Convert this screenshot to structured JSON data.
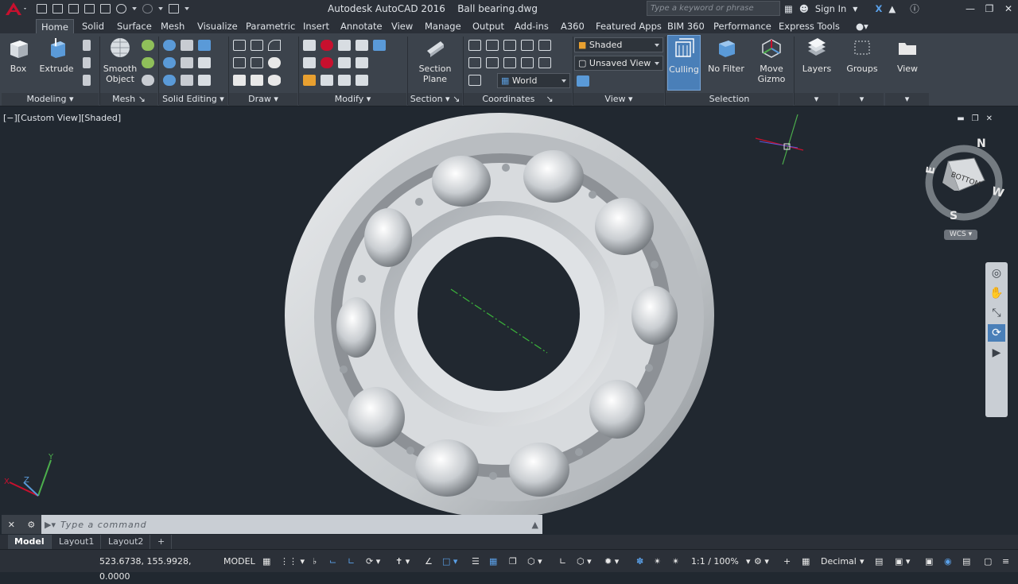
{
  "titlebar": {
    "app": "Autodesk AutoCAD 2016",
    "file": "Ball bearing.dwg",
    "search_placeholder": "Type a keyword or phrase",
    "sign_in": "Sign In"
  },
  "tabs": [
    "Home",
    "Solid",
    "Surface",
    "Mesh",
    "Visualize",
    "Parametric",
    "Insert",
    "Annotate",
    "View",
    "Manage",
    "Output",
    "Add-ins",
    "A360",
    "Featured Apps",
    "BIM 360",
    "Performance",
    "Express Tools"
  ],
  "ribbon": {
    "big_buttons": {
      "box": "Box",
      "extrude": "Extrude",
      "smooth": "Smooth Object",
      "section_plane": "Section Plane",
      "culling": "Culling",
      "no_filter": "No Filter",
      "move_gizmo": "Move Gizmo",
      "layers": "Layers",
      "groups": "Groups",
      "view": "View"
    },
    "panels": {
      "modeling": "Modeling",
      "mesh": "Mesh",
      "solid_editing": "Solid Editing",
      "draw": "Draw",
      "modify": "Modify",
      "section": "Section",
      "coordinates": "Coordinates",
      "view": "View",
      "selection": "Selection"
    },
    "dropdowns": {
      "visual_style": "Shaded",
      "named_view": "Unsaved View",
      "ucs": "World"
    }
  },
  "viewport": {
    "label": "[−][Custom View][Shaded]",
    "viewcube_face": "BOTTOM",
    "compass": {
      "n": "N",
      "s": "S",
      "e": "E",
      "w": "W"
    },
    "wcs": "WCS"
  },
  "command": {
    "placeholder": "Type a command"
  },
  "layout_tabs": [
    "Model",
    "Layout1",
    "Layout2"
  ],
  "status": {
    "coords": "523.6738, 155.9928, 0.0000",
    "space": "MODEL",
    "scale": "1:1 / 100%",
    "units": "Decimal"
  },
  "colors": {
    "accent": "#2c6fbd",
    "logo": "#c8102e",
    "background": "#212830"
  }
}
